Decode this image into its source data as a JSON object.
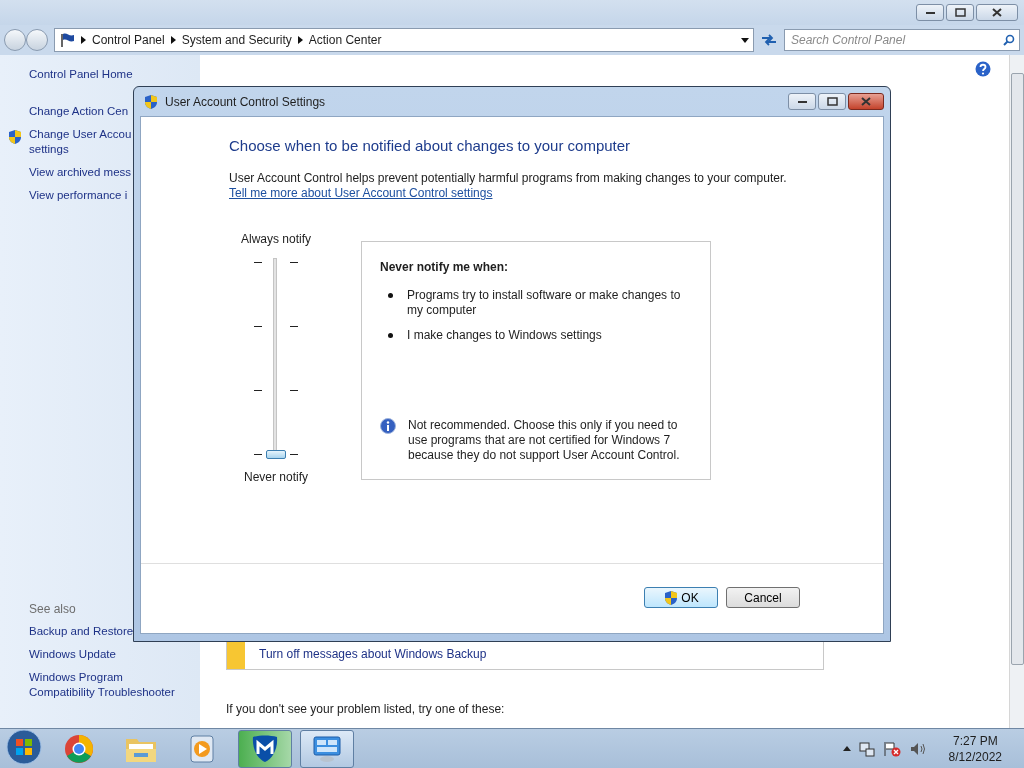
{
  "address_bar": {
    "crumbs": [
      "Control Panel",
      "System and Security",
      "Action Center"
    ]
  },
  "search": {
    "placeholder": "Search Control Panel"
  },
  "sidebar": {
    "items": [
      {
        "label": "Control Panel Home",
        "kind": "link"
      },
      {
        "label": "Change Action Cen",
        "kind": "link"
      },
      {
        "label": "Change User Accou\nsettings",
        "kind": "shield"
      },
      {
        "label": "View archived mess",
        "kind": "link"
      },
      {
        "label": "View performance i",
        "kind": "link"
      }
    ],
    "see_also_title": "See also",
    "see_also": [
      "Backup and Restore",
      "Windows Update",
      "Windows Program\nCompatibility Troubleshooter"
    ]
  },
  "content": {
    "backup_link": "Turn off messages about Windows Backup",
    "footer_text": "If you don't see your problem listed, try one of these:"
  },
  "dialog": {
    "title": "User Account Control Settings",
    "heading": "Choose when to be notified about changes to your computer",
    "description": "User Account Control helps prevent potentially harmful programs from making changes to your computer.",
    "link": "Tell me more about User Account Control settings",
    "slider": {
      "top_label": "Always notify",
      "bottom_label": "Never notify",
      "level": 0
    },
    "info": {
      "title": "Never notify me when:",
      "bullets": [
        "Programs try to install software or make changes to my computer",
        "I make changes to Windows settings"
      ],
      "note": "Not recommended. Choose this only if you need to use programs that are not certified for Windows 7 because they do not support User Account Control."
    },
    "buttons": [
      {
        "label": "OK",
        "kind": "shield",
        "selected": true
      },
      {
        "label": "Cancel",
        "kind": "plain",
        "selected": false
      }
    ]
  },
  "taskbar": {
    "apps": [
      {
        "kind": "chrome",
        "active": false
      },
      {
        "kind": "folder",
        "active": false
      },
      {
        "kind": "media",
        "active": false
      },
      {
        "kind": "malware",
        "active": true
      },
      {
        "kind": "control",
        "active": true
      }
    ],
    "time": "7:27 PM",
    "date": "8/12/2022"
  }
}
